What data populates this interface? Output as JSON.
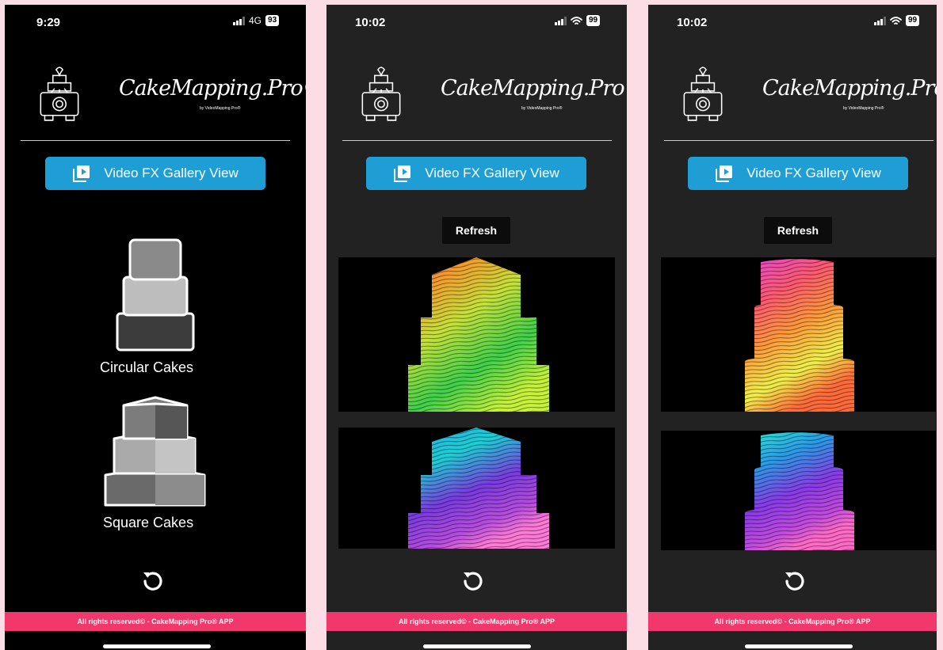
{
  "screens": [
    {
      "status": {
        "time": "9:29",
        "network": "4G",
        "battery": "93"
      },
      "header": {
        "logo_text": "CakeMapping.Pro©",
        "logo_sub": "by VideoMapping Pro®"
      },
      "gallery_button": {
        "label": "Video FX Gallery View"
      },
      "menu": [
        {
          "label": "Circular Cakes",
          "icon": "circular-cake-icon"
        },
        {
          "label": "Square Cakes",
          "icon": "square-cake-icon"
        }
      ],
      "reload_icon": "reload-icon",
      "footer": "All rights reserved© - CakeMapping Pro® APP"
    },
    {
      "status": {
        "time": "10:02",
        "battery": "99"
      },
      "header": {
        "logo_text": "CakeMapping.Pro©",
        "logo_sub": "by VideoMapping Pro®"
      },
      "gallery_button": {
        "label": "Video FX Gallery View"
      },
      "refresh_button": {
        "label": "Refresh"
      },
      "videos": [
        "square-cake-fx-green-orange",
        "square-cake-fx-purple-blue"
      ],
      "reload_icon": "reload-icon",
      "footer": "All rights reserved© - CakeMapping Pro® APP"
    },
    {
      "status": {
        "time": "10:02",
        "battery": "99"
      },
      "header": {
        "logo_text": "CakeMapping.Pro©",
        "logo_sub": "by VideoMapping Pro®"
      },
      "gallery_button": {
        "label": "Video FX Gallery View"
      },
      "refresh_button": {
        "label": "Refresh"
      },
      "videos": [
        "round-cake-fx-magenta-yellow",
        "round-cake-fx-cyan-purple"
      ],
      "reload_icon": "reload-icon",
      "footer": "All rights reserved© - CakeMapping Pro® APP"
    }
  ],
  "colors": {
    "accent": "#1e9ed4",
    "footer": "#f0386c",
    "background": "#fcdde6"
  }
}
